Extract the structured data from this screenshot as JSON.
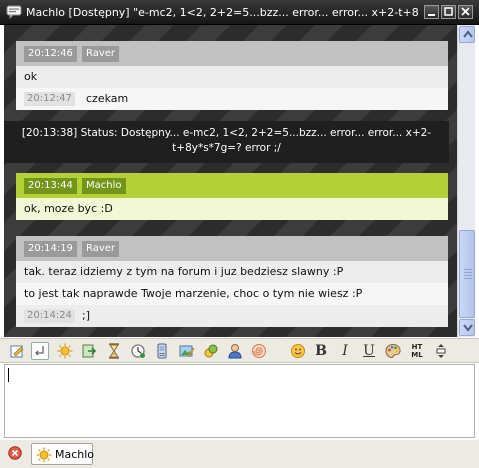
{
  "window": {
    "title": "Machlo [Dostępny] \"e-mc2, 1<2, 2+2=5...bzz... error... error... x+2-t+8y..."
  },
  "chat": {
    "messages": [
      {
        "time": "20:12:46",
        "author": "Raver",
        "lines": [
          "ok"
        ],
        "followup": {
          "time": "20:12:47",
          "text": "czekam"
        }
      },
      {
        "time": "20:13:44",
        "author": "Machlo",
        "lines": [
          "ok, moze byc :D"
        ]
      },
      {
        "time": "20:14:19",
        "author": "Raver",
        "lines": [
          "tak. teraz idziemy z tym na forum i juz bedziesz slawny :P",
          "to jest tak naprawde Twoje marzenie, choc o tym nie wiesz :P"
        ],
        "followup": {
          "time": "20:14:24",
          "text": ";]"
        }
      }
    ],
    "status": {
      "line1": "[20:13:38] Status: Dostępny... e-mc2, 1<2, 2+2=5...bzz... error... error... x+2-",
      "line2": "t+8y*s*7g=? error ;/"
    }
  },
  "toolbar": {
    "bold_label": "B",
    "italic_label": "I",
    "underline_label": "U",
    "html_label_top": "HT",
    "html_label_bottom": "ML"
  },
  "input": {
    "value": ""
  },
  "tabs": [
    {
      "label": "Machlo"
    }
  ],
  "colors": {
    "titlebar": "#1e1e1e",
    "own_header": "#b4d13a",
    "other_header": "#c1c1c1"
  }
}
